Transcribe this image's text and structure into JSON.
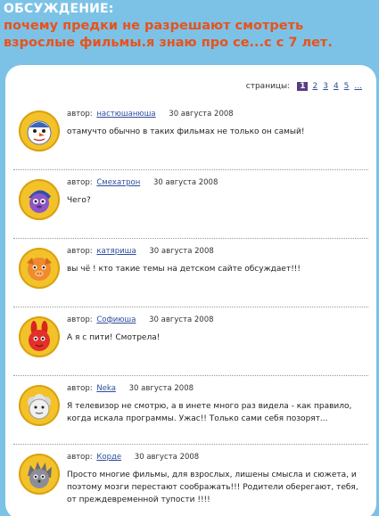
{
  "header": {
    "section_label": "ОБСУЖДЕНИЕ:",
    "topic_title": "почему предки не разрешают смотреть взрослые фильмы.я знаю про се...с с 7 лет."
  },
  "pager": {
    "label": "страницы:",
    "pages": [
      "1",
      "2",
      "3",
      "4",
      "5",
      "..."
    ],
    "current": "1"
  },
  "author_prefix": "автор:",
  "comments": [
    {
      "author": "настюшанюша",
      "date": "30 августа 2008",
      "text": "отамучто обычно в таких фильмах не только он самый!",
      "avatar_icon": "snowman-avatar-icon"
    },
    {
      "author": "Смехатрон",
      "date": "30 августа 2008",
      "text": "Чего?",
      "avatar_icon": "purple-hedgehog-avatar-icon"
    },
    {
      "author": "катяриша",
      "date": "30 августа 2008",
      "text": "вы чё ! кто такие темы на детском сайте обсуждает!!!",
      "avatar_icon": "orange-pig-avatar-icon"
    },
    {
      "author": "Софиюша",
      "date": "30 августа 2008",
      "text": "А я с пити! Смотрела!",
      "avatar_icon": "red-bunny-avatar-icon"
    },
    {
      "author": "Neka",
      "date": "30 августа 2008",
      "text": "Я телевизор не смотрю, а в инете много раз видела - как правило, когда искала программы. Ужас!! Только сами себя позорят...",
      "avatar_icon": "grey-sheep-avatar-icon"
    },
    {
      "author": "Корде",
      "date": "30 августа 2008",
      "text": "Просто многие фильмы, для взрослых, лишены смысла и сюжета, и поэтому мозги перестают соображать!!! Родители оберегают, тебя, от преждевременной тупости !!!!",
      "avatar_icon": "grey-hedgehog-avatar-icon"
    }
  ],
  "colors": {
    "background": "#7cc2e6",
    "title": "#e8521c",
    "link": "#2c4d9c",
    "current_page": "#5a3d86",
    "avatar_frame": "#f3c22a"
  }
}
